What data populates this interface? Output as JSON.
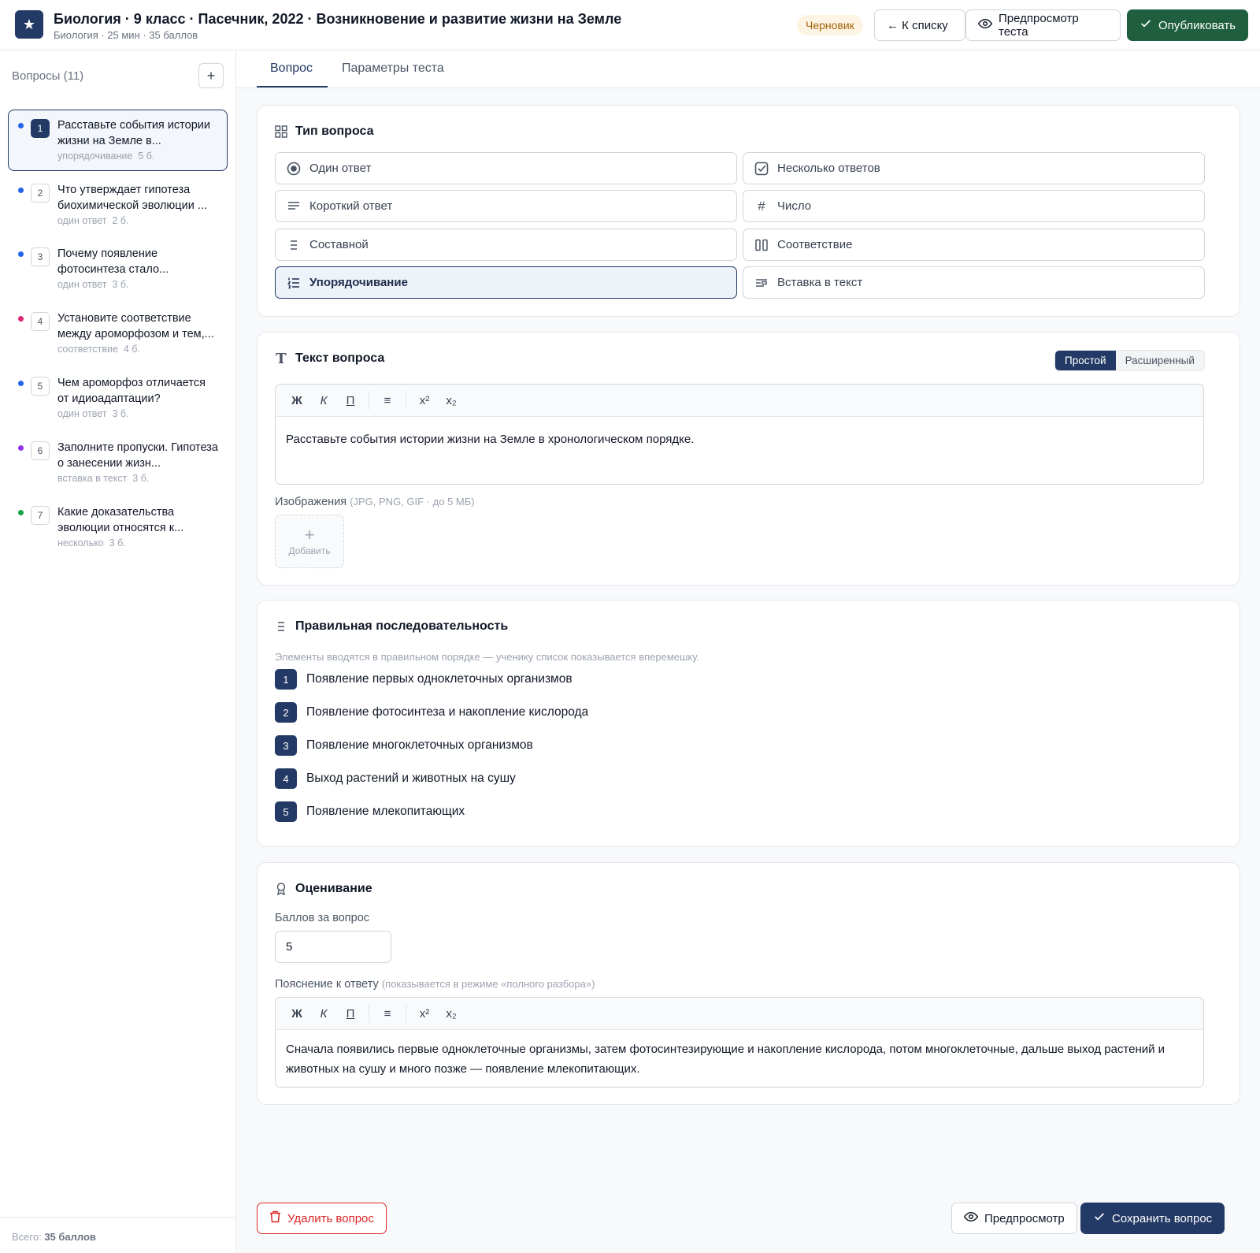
{
  "header": {
    "logo_icon": "star-icon",
    "title": "Биология · 9 класс · Пасечник, 2022 · Возникновение и развитие жизни на Земле",
    "subtitle": "Биология · 25 мин · 35 баллов",
    "status_badge": "Черновик",
    "back_label": "← К списку",
    "preview_test_label": "Предпросмотр теста",
    "publish_label": "Опубликовать"
  },
  "sidebar": {
    "heading": "Вопросы (11)",
    "add_icon": "plus-icon",
    "items": [
      {
        "num": "1",
        "text": "Расставьте события истории жизни на Земле в...",
        "type": "упорядочивание",
        "points": "5 б.",
        "color": "#2563eb"
      },
      {
        "num": "2",
        "text": "Что утверждает гипотеза биохимической эволюции ...",
        "type": "один ответ",
        "points": "2 б.",
        "color": "#2563eb"
      },
      {
        "num": "3",
        "text": "Почему появление фотосинтеза стало...",
        "type": "один ответ",
        "points": "3 б.",
        "color": "#2563eb"
      },
      {
        "num": "4",
        "text": "Установите соответствие между ароморфозом и тем,...",
        "type": "соответствие",
        "points": "4 б.",
        "color": "#db2777"
      },
      {
        "num": "5",
        "text": "Чем ароморфоз отличается от идиоадаптации?",
        "type": "один ответ",
        "points": "3 б.",
        "color": "#2563eb"
      },
      {
        "num": "6",
        "text": "Заполните пропуски. Гипотеза о занесении жизн...",
        "type": "вставка в текст",
        "points": "3 б.",
        "color": "#9333ea"
      },
      {
        "num": "7",
        "text": "Какие доказательства эволюции относятся к...",
        "type": "несколько",
        "points": "3 б.",
        "color": "#16a34a"
      }
    ],
    "footer_prefix": "Всего: ",
    "footer_total": "35 баллов"
  },
  "tabs": {
    "question": "Вопрос",
    "settings": "Параметры теста"
  },
  "question_type": {
    "title": "Тип вопроса",
    "options": [
      {
        "label": "Один ответ",
        "icon": "radio-icon"
      },
      {
        "label": "Несколько ответов",
        "icon": "checkbox-icon"
      },
      {
        "label": "Короткий ответ",
        "icon": "text-lines-icon"
      },
      {
        "label": "Число",
        "icon": "hash-icon"
      },
      {
        "label": "Составной",
        "icon": "list-icon"
      },
      {
        "label": "Соответствие",
        "icon": "columns-icon"
      },
      {
        "label": "Упорядочивание",
        "icon": "ordered-list-icon",
        "selected": true
      },
      {
        "label": "Вставка в текст",
        "icon": "insert-text-icon"
      }
    ]
  },
  "question_text": {
    "title": "Текст вопроса",
    "mode_simple": "Простой",
    "mode_advanced": "Расширенный",
    "toolbar": {
      "bold": "Ж",
      "italic": "К",
      "underline": "П",
      "list": "≡",
      "sup": "x²",
      "sub": "x₂"
    },
    "body": "Расставьте события истории жизни на Земле в хронологическом порядке.",
    "images_label": "Изображения",
    "images_hint": "(JPG, PNG, GIF · до 5 МБ)",
    "add_image": "Добавить"
  },
  "sequence": {
    "title": "Правильная последовательность",
    "hint": "Элементы вводятся в правильном порядке — ученику список показывается вперемешку.",
    "items": [
      {
        "num": "1",
        "text": "Появление первых одноклеточных организмов"
      },
      {
        "num": "2",
        "text": "Появление фотосинтеза и накопление кислорода"
      },
      {
        "num": "3",
        "text": "Появление многоклеточных организмов"
      },
      {
        "num": "4",
        "text": "Выход растений и животных на сушу"
      },
      {
        "num": "5",
        "text": "Появление млекопитающих"
      }
    ]
  },
  "grading": {
    "title": "Оценивание",
    "points_label": "Баллов за вопрос",
    "points_value": "5",
    "explanation_label": "Пояснение к ответу",
    "explanation_hint": "(показывается в режиме «полного разбора»)",
    "explanation_body": "Сначала появились первые одноклеточные организмы, затем фотосинтезирующие и накопление кислорода, потом многоклеточные, дальше выход растений и животных на сушу и много позже — появление млекопитающих."
  },
  "footer": {
    "delete_label": "Удалить вопрос",
    "preview_label": "Предпросмотр",
    "save_label": "Сохранить вопрос"
  },
  "colors": {
    "primary": "#243a66",
    "publish": "#1f5f3f",
    "danger": "#dc2626",
    "draft_bg": "#fdf4e3"
  }
}
